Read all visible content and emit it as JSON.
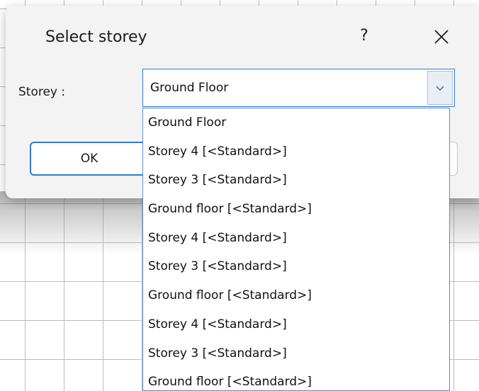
{
  "dialog": {
    "title": "Select storey",
    "help_label": "?",
    "close_icon": "close-icon"
  },
  "form": {
    "storey_label": "Storey :",
    "selected_value": "Ground Floor",
    "dropdown_icon": "chevron-down-icon"
  },
  "buttons": {
    "ok_label": "OK",
    "cancel_label": ""
  },
  "dropdown": {
    "options": [
      "Ground Floor",
      "Storey 4 [<Standard>]",
      "Storey 3 [<Standard>]",
      "Ground floor [<Standard>]",
      "Storey 4 [<Standard>]",
      "Storey 3 [<Standard>]",
      "Ground floor [<Standard>]",
      "Storey 4 [<Standard>]",
      "Storey 3 [<Standard>]",
      "Ground floor [<Standard>]"
    ]
  },
  "colors": {
    "accent": "#2f7bd6",
    "dialog_bg": "#f3f3f3",
    "grid_line": "#bdbdbd"
  }
}
